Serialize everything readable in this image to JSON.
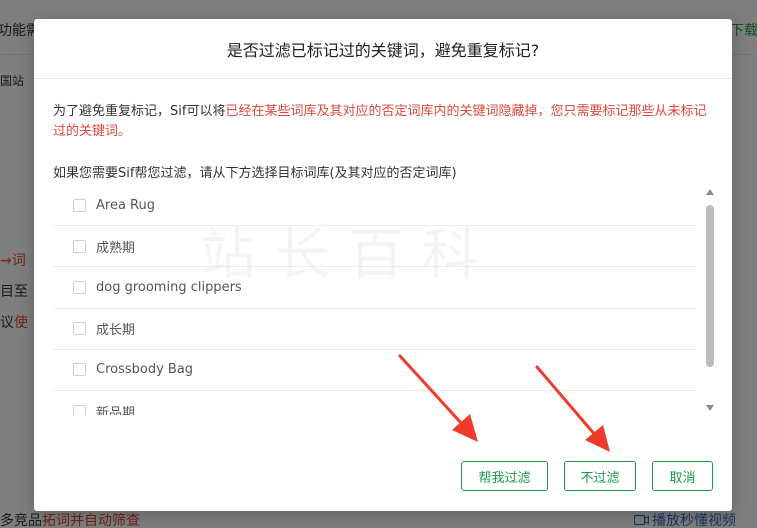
{
  "background": {
    "top_left": "功能需",
    "top_right": "下载",
    "tab": "国站",
    "side_a": "→词",
    "side_b": "目至",
    "side_c_dark": "议",
    "side_c_red": "使",
    "bottom_left_dark": "多竞品",
    "bottom_left_red": "拓词并自动筛查",
    "bottom_right": "播放秒懂视频"
  },
  "modal": {
    "title": "是否过滤已标记过的关键词，避免重复标记?",
    "intro_plain": "为了避免重复标记，Sif可以将",
    "intro_warn": "已经在某些词库及其对应的否定词库内的关键词隐藏掉，您只需要标记那些从未标记过的关键词。",
    "instruction": "如果您需要Sif帮您过滤，请从下方选择目标词库(及其对应的否定词库)",
    "items": [
      {
        "label": "Area Rug"
      },
      {
        "label": "成熟期"
      },
      {
        "label": "dog grooming clippers"
      },
      {
        "label": "成长期"
      },
      {
        "label": "Crossbody Bag"
      },
      {
        "label": "新品期"
      }
    ],
    "buttons": {
      "filter": "帮我过滤",
      "no_filter": "不过滤",
      "cancel": "取消"
    }
  },
  "watermark": "站长百科",
  "colors": {
    "accent_green": "#1a9a4a",
    "warning_red": "#e0463a",
    "arrow_red": "#f03a2a"
  }
}
